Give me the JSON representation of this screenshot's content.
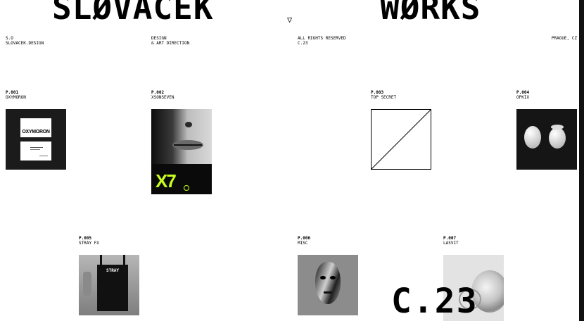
{
  "header": {
    "left_title": "SLØVACEK",
    "right_title": "WØRKS",
    "menu_icon": "triangle-down-icon"
  },
  "meta": [
    {
      "line1": "S.O",
      "line2": "SLOVACEK.DESIGN"
    },
    {
      "line1": "DESIGN",
      "line2": "& ART DIRECTION"
    },
    {
      "line1": "ALL RIGHTS RESERVED",
      "line2": "C.23"
    },
    {
      "line1": "PRAGUE, CZ",
      "line2": ""
    }
  ],
  "projects": [
    {
      "code": "P.001",
      "name": "OXYMORON",
      "thumb_text": "OXYMORON"
    },
    {
      "code": "P.002",
      "name": "XSONSEVEN",
      "thumb_text": "X7"
    },
    {
      "code": "P.003",
      "name": "TOP SECRET"
    },
    {
      "code": "P.004",
      "name": "OPKIX"
    },
    {
      "code": "P.005",
      "name": "STRAY FX",
      "thumb_text": "STRAY"
    },
    {
      "code": "P.006",
      "name": "MISC"
    },
    {
      "code": "P.007",
      "name": "LASVIT"
    }
  ],
  "footer_label": "C.23",
  "colors": {
    "background": "#ffffff",
    "text": "#000000",
    "accent": "#c8ff1e",
    "scrollbar": "#111111"
  }
}
